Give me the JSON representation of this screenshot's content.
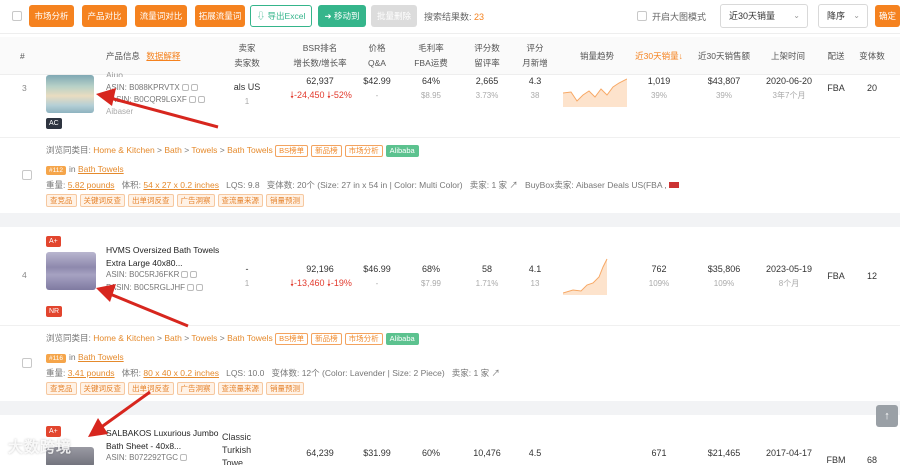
{
  "toolbar": {
    "buttons": [
      "市场分析",
      "产品对比",
      "流量词对比",
      "拓展流量词"
    ],
    "export_label": "导出Excel",
    "move_label": "移动到",
    "batch_delete_label": "批量删除",
    "result_label": "搜索结果数:",
    "result_count": "23",
    "bigimage_label": "开启大图模式",
    "sort_field": "近30天销量",
    "sort_order": "降序",
    "confirm_label": "确定"
  },
  "header": {
    "index": "#",
    "product_info": "产品信息",
    "data_explain": "数据解释",
    "seller": "卖家",
    "seller_count": "卖家数",
    "bsr": "BSR排名",
    "bsr_growth": "增长数/增长率",
    "price": "价格",
    "qa": "Q&A",
    "margin": "毛利率",
    "fba_fee": "FBA运费",
    "rating_count": "评分数",
    "review_rate": "留评率",
    "rating": "评分",
    "monthly_new": "月新增",
    "sales_trend": "销量趋势",
    "sales30": "近30天销量",
    "sales_amount30": "近30天销售额",
    "launch": "上架时间",
    "delivery": "配送",
    "variants": "变体数"
  },
  "rows": [
    {
      "index": "3",
      "title": "Aiuo...",
      "asin": "ASIN: B088KPRVTX",
      "pasin": "PASIN: B0CQR9LGXF",
      "brand": "Aibaser",
      "badge": "AC",
      "seller": "als US",
      "seller_count": "1",
      "bsr": "62,937",
      "bsr_change": "-24,450",
      "bsr_rate": "-52%",
      "price": "$42.99",
      "qa": "-",
      "margin": "64%",
      "fba": "$8.95",
      "rating_count": "2,665",
      "review_rate": "3.73%",
      "rating": "4.3",
      "monthly_new": "38",
      "sales30": "1,019",
      "sales30_rate": "39%",
      "amount30": "$43,807",
      "amount30_rate": "39%",
      "launch": "2020-06-20",
      "launch_age": "3年7个月",
      "delivery": "FBA",
      "variants": "20",
      "category_label": "浏览同类目:",
      "category": [
        "Home & Kitchen",
        "Bath",
        "Towels",
        "Bath Towels"
      ],
      "cat_tags": [
        "BS榜单",
        "新品榜",
        "市场分析",
        "Alibaba"
      ],
      "rank_badge": "#112",
      "rank_in": "in",
      "rank_cat": "Bath Towels",
      "weight_label": "重量:",
      "weight": "5.82 pounds",
      "volume_label": "体积:",
      "volume": "54 x 27 x 0.2 inches",
      "lqs": "LQS: 9.8",
      "variant_info": "变体数: 20个 (Size: 27 in x 54 in | Color: Multi Color)",
      "sellers_info": "卖家: 1 家",
      "buybox": "BuyBox卖家: Aibaser Deals US(FBA ,",
      "tools": [
        "查竞品",
        "关键词反查",
        "出单词反查",
        "广告洞察",
        "查流量来源",
        "销量预测"
      ]
    },
    {
      "index": "4",
      "badge_top": "A+",
      "title": "HVMS Oversized Bath Towels Extra Large 40x80...",
      "asin": "ASIN: B0C5RJ6FKR",
      "pasin": "PASIN: B0C5RGLJHF",
      "badge": "NR",
      "seller": "-",
      "seller_count": "1",
      "bsr": "92,196",
      "bsr_change": "-13,460",
      "bsr_rate": "-19%",
      "price": "$46.99",
      "qa": "-",
      "margin": "68%",
      "fba": "$7.99",
      "rating_count": "58",
      "review_rate": "1.71%",
      "rating": "4.1",
      "monthly_new": "13",
      "sales30": "762",
      "sales30_rate": "109%",
      "amount30": "$35,806",
      "amount30_rate": "109%",
      "launch": "2023-05-19",
      "launch_age": "8个月",
      "delivery": "FBA",
      "variants": "12",
      "category_label": "浏览同类目:",
      "category": [
        "Home & Kitchen",
        "Bath",
        "Towels",
        "Bath Towels"
      ],
      "cat_tags": [
        "BS榜单",
        "新品榜",
        "市场分析",
        "Alibaba"
      ],
      "rank_badge": "#116",
      "rank_in": "in",
      "rank_cat": "Bath Towels",
      "weight_label": "重量:",
      "weight": "3.41 pounds",
      "volume_label": "体积:",
      "volume": "80 x 40 x 0.2 inches",
      "lqs": "LQS: 10.0",
      "variant_info": "变体数: 12个 (Color: Lavender | Size: 2 Piece)",
      "sellers_info": "卖家: 1 家",
      "tools": [
        "查竞品",
        "关键词反查",
        "出单词反查",
        "广告洞察",
        "查流量来源",
        "销量预测"
      ]
    },
    {
      "index": "",
      "badge_top": "A+",
      "title": "SALBAKOS Luxurious Jumbo Bath Sheet - 40x8...",
      "asin": "ASIN: B072292TGC",
      "seller": "Classic Turkish Towe",
      "bsr": "64,239",
      "price": "$31.99",
      "margin": "60%",
      "rating_count": "10,476",
      "rating": "4.5",
      "sales30": "671",
      "amount30": "$21,465",
      "launch": "2017-04-17",
      "delivery": "FBM",
      "variants": "68"
    }
  ],
  "watermark": "大数跨境",
  "colors": {
    "accent": "#f5821f",
    "green": "#35b58b",
    "red": "#e23b2e",
    "link": "#e58a2c"
  },
  "icons": [
    "checkbox-icon",
    "export-icon",
    "move-icon",
    "chevron-down-icon",
    "arrow-down-icon",
    "arrow-up-icon",
    "copy-icon",
    "flag-icon"
  ]
}
